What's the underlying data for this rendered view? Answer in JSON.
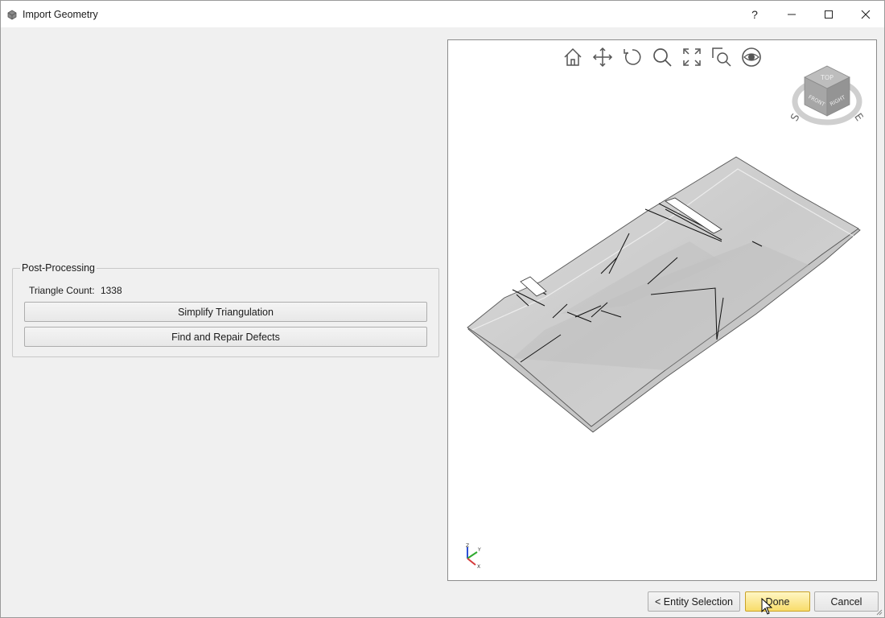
{
  "window": {
    "title": "Import Geometry",
    "help_glyph": "?",
    "icons": [
      "app-icon",
      "help-icon",
      "minimize-icon",
      "maximize-icon",
      "close-icon"
    ]
  },
  "post_processing": {
    "legend": "Post-Processing",
    "triangle_count_label": "Triangle Count:",
    "triangle_count_value": "1338",
    "simplify_label": "Simplify Triangulation",
    "repair_label": "Find and Repair Defects"
  },
  "viewer": {
    "toolbar": [
      "home-icon",
      "pan-icon",
      "rotate-icon",
      "zoom-icon",
      "fit-icon",
      "zoom-window-icon",
      "look-icon"
    ],
    "navcube": {
      "face_top": "TOP",
      "face_left": "FRONT",
      "face_right": "RIGHT",
      "compass_s": "S",
      "compass_e": "E"
    },
    "axes": {
      "z": "Z",
      "y": "Y",
      "x": "X"
    },
    "colors": {
      "surface": "#d2d2d2",
      "surface_dark": "#bcbcbc",
      "edge": "#444444"
    }
  },
  "footer": {
    "back_label": "< Entity Selection",
    "done_label": "Done",
    "cancel_label": "Cancel"
  }
}
